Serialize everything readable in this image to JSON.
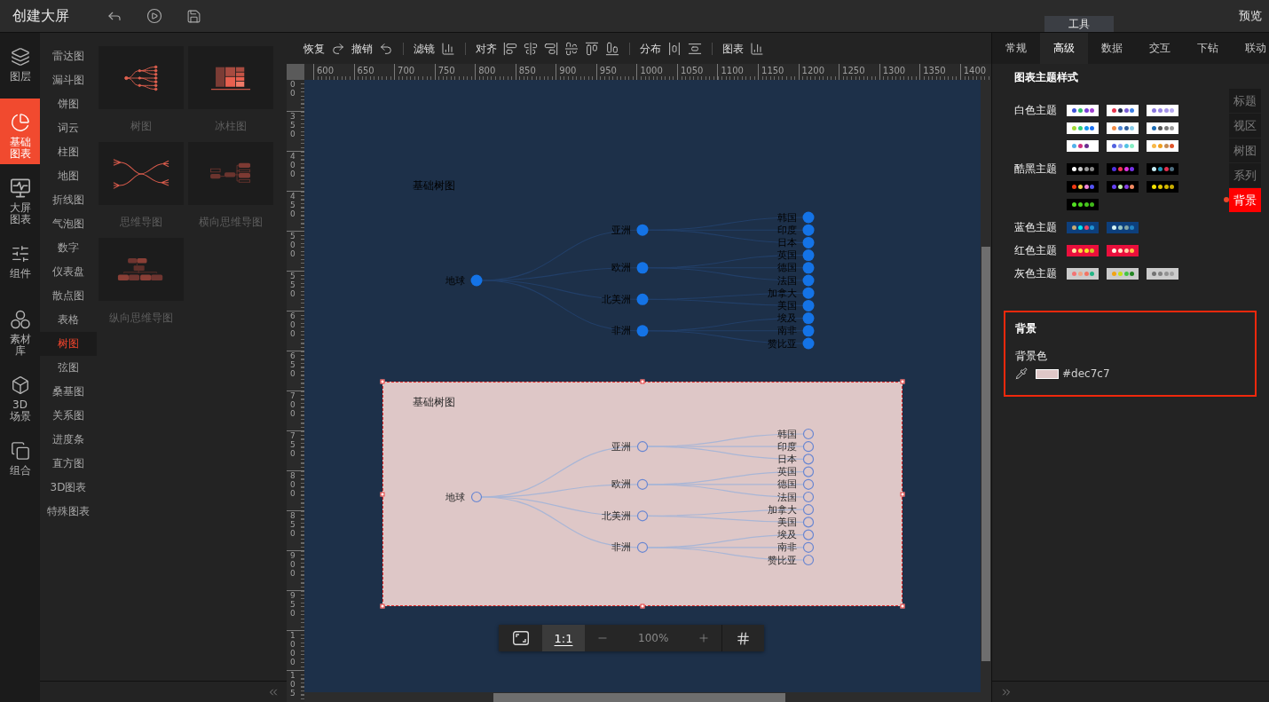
{
  "top_bar": {
    "title": "创建大屏",
    "tools_tab": "工具",
    "preview": "预览"
  },
  "nav_rail": [
    {
      "label": "图层",
      "selected": false
    },
    {
      "label": "基础图表",
      "selected": true
    },
    {
      "label": "大屏图表",
      "selected": false
    },
    {
      "label": "组件",
      "selected": false
    },
    {
      "label": "素材库",
      "selected": false
    },
    {
      "label": "3D场景",
      "selected": false
    },
    {
      "label": "组合",
      "selected": false
    }
  ],
  "categories": [
    {
      "label": "雷达图",
      "selected": false
    },
    {
      "label": "漏斗图",
      "selected": false
    },
    {
      "label": "饼图",
      "selected": false
    },
    {
      "label": "词云",
      "selected": false
    },
    {
      "label": "柱图",
      "selected": false
    },
    {
      "label": "地图",
      "selected": false
    },
    {
      "label": "折线图",
      "selected": false
    },
    {
      "label": "气泡图",
      "selected": false
    },
    {
      "label": "数字",
      "selected": false
    },
    {
      "label": "仪表盘",
      "selected": false
    },
    {
      "label": "散点图",
      "selected": false
    },
    {
      "label": "表格",
      "selected": false
    },
    {
      "label": "树图",
      "selected": true
    },
    {
      "label": "弦图",
      "selected": false
    },
    {
      "label": "桑基图",
      "selected": false
    },
    {
      "label": "关系图",
      "selected": false
    },
    {
      "label": "进度条",
      "selected": false
    },
    {
      "label": "直方图",
      "selected": false
    },
    {
      "label": "3D图表",
      "selected": false
    },
    {
      "label": "特殊图表",
      "selected": false
    }
  ],
  "chart_types": [
    {
      "label": "树图"
    },
    {
      "label": "冰柱图"
    },
    {
      "label": "思维导图"
    },
    {
      "label": "横向思维导图"
    },
    {
      "label": "纵向思维导图"
    }
  ],
  "toolbar": [
    "恢复",
    "撤销",
    "滤镜",
    "对齐",
    "分布",
    "图表"
  ],
  "rulers": {
    "horizontal": [
      "600",
      "650",
      "700",
      "750",
      "800",
      "850",
      "900",
      "950",
      "1000",
      "1050",
      "1100",
      "1150",
      "1200",
      "1250",
      "1300",
      "1350",
      "1400"
    ],
    "vertical": [
      "00",
      "350",
      "400",
      "450",
      "500",
      "550",
      "600",
      "650",
      "700",
      "750",
      "800",
      "850",
      "900",
      "950",
      "1000",
      "105"
    ]
  },
  "canvas": {
    "charts": [
      {
        "title": "基础树图",
        "kind": "filled",
        "selected": false,
        "tree": {
          "label": "地球",
          "children": [
            {
              "label": "亚洲",
              "children": [
                {
                  "label": "韩国"
                },
                {
                  "label": "印度"
                },
                {
                  "label": "日本"
                }
              ]
            },
            {
              "label": "欧洲",
              "children": [
                {
                  "label": "英国"
                },
                {
                  "label": "德国"
                },
                {
                  "label": "法国"
                }
              ]
            },
            {
              "label": "北美洲",
              "children": [
                {
                  "label": "加拿大"
                },
                {
                  "label": "美国"
                }
              ]
            },
            {
              "label": "非洲",
              "children": [
                {
                  "label": "埃及"
                },
                {
                  "label": "南非"
                },
                {
                  "label": "赞比亚"
                }
              ]
            }
          ]
        }
      },
      {
        "title": "基础树图",
        "kind": "hollow",
        "selected": true,
        "color": "#dec7c7",
        "tree": {
          "label": "地球",
          "children": [
            {
              "label": "亚洲",
              "children": [
                {
                  "label": "韩国"
                },
                {
                  "label": "印度"
                },
                {
                  "label": "日本"
                }
              ]
            },
            {
              "label": "欧洲",
              "children": [
                {
                  "label": "英国"
                },
                {
                  "label": "德国"
                },
                {
                  "label": "法国"
                }
              ]
            },
            {
              "label": "北美洲",
              "children": [
                {
                  "label": "加拿大"
                },
                {
                  "label": "美国"
                }
              ]
            },
            {
              "label": "非洲",
              "children": [
                {
                  "label": "埃及"
                },
                {
                  "label": "南非"
                },
                {
                  "label": "赞比亚"
                }
              ]
            }
          ]
        }
      }
    ]
  },
  "zoom_bar": {
    "actual_size": {
      "label": "1:1",
      "selected": true
    },
    "zoom_level": "100%"
  },
  "inspector": {
    "tabs": [
      {
        "label": "常规",
        "selected": false
      },
      {
        "label": "高级",
        "selected": true
      },
      {
        "label": "数据",
        "selected": false
      },
      {
        "label": "交互",
        "selected": false
      },
      {
        "label": "下钻",
        "selected": false
      },
      {
        "label": "联动",
        "selected": false
      }
    ],
    "theme_title": "图表主题样式",
    "theme_groups": [
      {
        "label": "白色主题",
        "swatches": [
          {
            "color": "#ffffff",
            "dots": [
              {
                "color": "#3f54d9"
              },
              {
                "color": "#2fc06a"
              },
              {
                "color": "#7b3fd8"
              },
              {
                "color": "#a040d0"
              }
            ]
          },
          {
            "color": "#ffffff",
            "dots": [
              {
                "color": "#e8344d"
              },
              {
                "color": "#1c2b4e"
              },
              {
                "color": "#7a5cd6"
              },
              {
                "color": "#3b7fe6"
              }
            ]
          },
          {
            "color": "#ffffff",
            "dots": [
              {
                "color": "#8a78de"
              },
              {
                "color": "#9886e4"
              },
              {
                "color": "#a796ea"
              },
              {
                "color": "#b8aaf0"
              }
            ]
          },
          {
            "color": "#ffffff",
            "dots": [
              {
                "color": "#a3d935"
              },
              {
                "color": "#2fd27a"
              },
              {
                "color": "#1596f0"
              },
              {
                "color": "#1a6ff0"
              }
            ]
          },
          {
            "color": "#ffffff",
            "dots": [
              {
                "color": "#f28c48"
              },
              {
                "color": "#4a84d4"
              },
              {
                "color": "#2f5f9e"
              },
              {
                "color": "#86cce8"
              }
            ]
          },
          {
            "color": "#ffffff",
            "dots": [
              {
                "color": "#1c6cb4"
              },
              {
                "color": "#555555"
              },
              {
                "color": "#777777"
              },
              {
                "color": "#999999"
              }
            ]
          },
          {
            "color": "#ffffff",
            "dots": [
              {
                "color": "#52b2ea"
              },
              {
                "color": "#d0307f"
              },
              {
                "color": "#6a3090"
              }
            ]
          },
          {
            "color": "#ffffff",
            "dots": [
              {
                "color": "#5262e0"
              },
              {
                "color": "#94a4f2"
              },
              {
                "color": "#52c2e2"
              },
              {
                "color": "#86f0c4"
              }
            ]
          },
          {
            "color": "#ffffff",
            "dots": [
              {
                "color": "#f8b848"
              },
              {
                "color": "#f0a020"
              },
              {
                "color": "#c48a52"
              },
              {
                "color": "#e0542a"
              }
            ]
          }
        ]
      },
      {
        "label": "酷黑主题",
        "swatches": [
          {
            "color": "#000000",
            "dots": [
              {
                "color": "#ffffff"
              },
              {
                "color": "#cccccc"
              },
              {
                "color": "#9a9a9a"
              },
              {
                "color": "#888888"
              }
            ]
          },
          {
            "color": "#000000",
            "dots": [
              {
                "color": "#5032e0"
              },
              {
                "color": "#f03454"
              },
              {
                "color": "#e032e0"
              },
              {
                "color": "#7432e6"
              }
            ]
          },
          {
            "color": "#000000",
            "dots": [
              {
                "color": "#c4ecf4"
              },
              {
                "color": "#2394b4"
              },
              {
                "color": "#e2304e"
              },
              {
                "color": "#4e6e80"
              }
            ]
          },
          {
            "color": "#000000",
            "dots": [
              {
                "color": "#f23a12"
              },
              {
                "color": "#f4d444"
              },
              {
                "color": "#f288d8"
              },
              {
                "color": "#5454f2"
              }
            ]
          },
          {
            "color": "#000000",
            "dots": [
              {
                "color": "#6442f2"
              },
              {
                "color": "#c4f2a4"
              },
              {
                "color": "#8442e4"
              },
              {
                "color": "#f28a62"
              }
            ]
          },
          {
            "color": "#000000",
            "dots": [
              {
                "color": "#f4e200"
              },
              {
                "color": "#e4c800"
              },
              {
                "color": "#d4b800"
              },
              {
                "color": "#c8ac00"
              }
            ]
          },
          {
            "color": "#000000",
            "dots": [
              {
                "color": "#52e022"
              },
              {
                "color": "#4cd21e"
              },
              {
                "color": "#46c41c"
              },
              {
                "color": "#40b81a"
              }
            ]
          }
        ]
      },
      {
        "label": "蓝色主题",
        "swatches": [
          {
            "color": "#0d3f7c",
            "dots": [
              {
                "color": "#c8aa72"
              },
              {
                "color": "#00e8f2"
              },
              {
                "color": "#f04462"
              },
              {
                "color": "#2294d4"
              }
            ]
          },
          {
            "color": "#0d3f7c",
            "dots": [
              {
                "color": "#d4f2f2"
              },
              {
                "color": "#94c4c4"
              },
              {
                "color": "#82a4a4"
              },
              {
                "color": "#2284c4"
              }
            ]
          }
        ]
      },
      {
        "label": "红色主题",
        "swatches": [
          {
            "color": "#ea0f3c",
            "dots": [
              {
                "color": "#ffe4a4"
              },
              {
                "color": "#ffd444"
              },
              {
                "color": "#f2e424"
              },
              {
                "color": "#d4c424"
              }
            ]
          },
          {
            "color": "#ea0f3c",
            "dots": [
              {
                "color": "#fff2e4"
              },
              {
                "color": "#ffe2c4"
              },
              {
                "color": "#ffd2a4"
              },
              {
                "color": "#ffc444"
              }
            ]
          }
        ]
      },
      {
        "label": "灰色主题",
        "swatches": [
          {
            "color": "#cccccc",
            "dots": [
              {
                "color": "#f27474"
              },
              {
                "color": "#f2a484"
              },
              {
                "color": "#f27464"
              },
              {
                "color": "#22b484"
              }
            ]
          },
          {
            "color": "#cccccc",
            "dots": [
              {
                "color": "#f2a414"
              },
              {
                "color": "#c4e214"
              },
              {
                "color": "#44c444"
              },
              {
                "color": "#228422"
              }
            ]
          },
          {
            "color": "#cccccc",
            "dots": [
              {
                "color": "#727272"
              },
              {
                "color": "#828282"
              },
              {
                "color": "#929292"
              },
              {
                "color": "#a2a2a2"
              }
            ]
          }
        ]
      }
    ],
    "side_tabs": [
      {
        "label": "标题",
        "selected": false
      },
      {
        "label": "视区",
        "selected": false
      },
      {
        "label": "树图",
        "selected": false
      },
      {
        "label": "系列",
        "selected": false
      },
      {
        "label": "背景",
        "selected": true
      }
    ],
    "background": {
      "title": "背景",
      "color_label": "背景色",
      "color": "#dec7c7",
      "value": "#dec7c7"
    }
  }
}
